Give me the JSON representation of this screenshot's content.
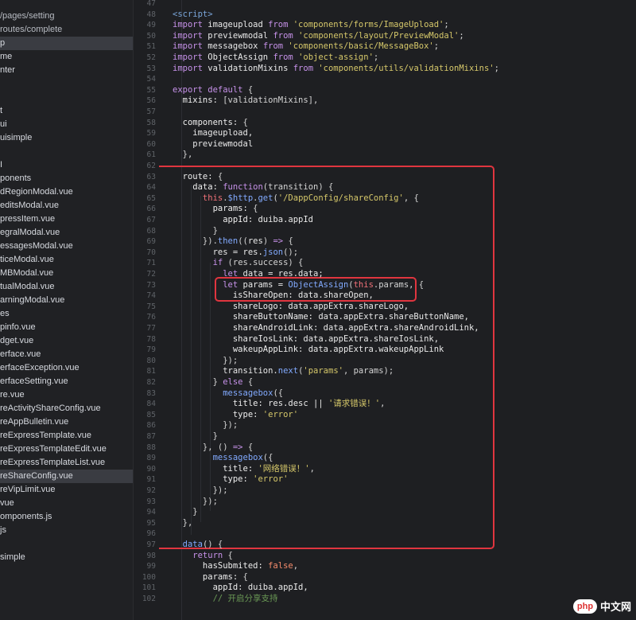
{
  "sidebar": {
    "items": [
      {
        "label": "/pages/setting",
        "style": "path"
      },
      {
        "label": "routes/complete",
        "style": "path"
      },
      {
        "label": "p",
        "style": "active"
      },
      {
        "label": "me",
        "style": ""
      },
      {
        "label": "nter",
        "style": ""
      },
      {
        "label": "",
        "style": ""
      },
      {
        "label": "",
        "style": ""
      },
      {
        "label": "t",
        "style": ""
      },
      {
        "label": "ui",
        "style": ""
      },
      {
        "label": "uisimple",
        "style": ""
      },
      {
        "label": "",
        "style": ""
      },
      {
        "label": "I",
        "style": ""
      },
      {
        "label": "ponents",
        "style": ""
      },
      {
        "label": "dRegionModal.vue",
        "style": ""
      },
      {
        "label": "editsModal.vue",
        "style": ""
      },
      {
        "label": "pressItem.vue",
        "style": ""
      },
      {
        "label": "egralModal.vue",
        "style": ""
      },
      {
        "label": "essagesModal.vue",
        "style": ""
      },
      {
        "label": "ticeModal.vue",
        "style": ""
      },
      {
        "label": "MBModal.vue",
        "style": ""
      },
      {
        "label": "tualModal.vue",
        "style": ""
      },
      {
        "label": "arningModal.vue",
        "style": ""
      },
      {
        "label": "es",
        "style": ""
      },
      {
        "label": "pinfo.vue",
        "style": ""
      },
      {
        "label": "dget.vue",
        "style": ""
      },
      {
        "label": "erface.vue",
        "style": ""
      },
      {
        "label": "erfaceException.vue",
        "style": ""
      },
      {
        "label": "erfaceSetting.vue",
        "style": ""
      },
      {
        "label": "re.vue",
        "style": ""
      },
      {
        "label": "reActivityShareConfig.vue",
        "style": ""
      },
      {
        "label": "reAppBulletin.vue",
        "style": ""
      },
      {
        "label": "reExpressTemplate.vue",
        "style": ""
      },
      {
        "label": "reExpressTemplateEdit.vue",
        "style": ""
      },
      {
        "label": "reExpressTemplateList.vue",
        "style": ""
      },
      {
        "label": "reShareConfig.vue",
        "style": "active"
      },
      {
        "label": "reVipLimit.vue",
        "style": ""
      },
      {
        "label": "vue",
        "style": ""
      },
      {
        "label": "omponents.js",
        "style": ""
      },
      {
        "label": "js",
        "style": ""
      },
      {
        "label": "",
        "style": ""
      },
      {
        "label": "simple",
        "style": ""
      }
    ]
  },
  "editor": {
    "line_numbers": [
      "47",
      "48",
      "49",
      "50",
      "51",
      "52",
      "53",
      "54",
      "55",
      "56",
      "57",
      "58",
      "59",
      "60",
      "61",
      "62",
      "63",
      "64",
      "65",
      "66",
      "67",
      "68",
      "69",
      "70",
      "71",
      "72",
      "73",
      "74",
      "75",
      "76",
      "77",
      "78",
      "79",
      "80",
      "81",
      "82",
      "83",
      "84",
      "85",
      "86",
      "87",
      "88",
      "89",
      "90",
      "91",
      "92",
      "93",
      "94",
      "95",
      "96",
      "97",
      "98",
      "99",
      "100",
      "101",
      "102"
    ],
    "lines": [
      [],
      [
        [
          "tag",
          "<script>"
        ]
      ],
      [
        [
          "kw",
          "import "
        ],
        [
          "id",
          "imageupload "
        ],
        [
          "kw",
          "from "
        ],
        [
          "str",
          "'components/forms/ImageUpload'"
        ],
        [
          "punc",
          ";"
        ]
      ],
      [
        [
          "kw",
          "import "
        ],
        [
          "id",
          "previewmodal "
        ],
        [
          "kw",
          "from "
        ],
        [
          "str",
          "'components/layout/PreviewModal'"
        ],
        [
          "punc",
          ";"
        ]
      ],
      [
        [
          "kw",
          "import "
        ],
        [
          "id",
          "messagebox "
        ],
        [
          "kw",
          "from "
        ],
        [
          "str",
          "'components/basic/MessageBox'"
        ],
        [
          "punc",
          ";"
        ]
      ],
      [
        [
          "kw",
          "import "
        ],
        [
          "id",
          "ObjectAssign "
        ],
        [
          "kw",
          "from "
        ],
        [
          "str",
          "'object-assign'"
        ],
        [
          "punc",
          ";"
        ]
      ],
      [
        [
          "kw",
          "import "
        ],
        [
          "id",
          "validationMixins "
        ],
        [
          "kw",
          "from "
        ],
        [
          "str",
          "'components/utils/validationMixins'"
        ],
        [
          "punc",
          ";"
        ]
      ],
      [],
      [
        [
          "kw",
          "export default "
        ],
        [
          "punc",
          "{"
        ]
      ],
      [
        [
          "prop",
          "  mixins: "
        ],
        [
          "punc",
          "[validationMixins],"
        ]
      ],
      [],
      [
        [
          "prop",
          "  components: "
        ],
        [
          "punc",
          "{"
        ]
      ],
      [
        [
          "id",
          "    imageupload,"
        ]
      ],
      [
        [
          "id",
          "    previewmodal"
        ]
      ],
      [
        [
          "punc",
          "  },"
        ]
      ],
      [],
      [
        [
          "prop",
          "  route: "
        ],
        [
          "punc",
          "{"
        ]
      ],
      [
        [
          "prop",
          "    data: "
        ],
        [
          "kw",
          "function"
        ],
        [
          "punc",
          "(transition) {"
        ]
      ],
      [
        [
          "this",
          "      this"
        ],
        [
          "punc",
          "."
        ],
        [
          "fn",
          "$http"
        ],
        [
          "punc",
          "."
        ],
        [
          "fn",
          "get"
        ],
        [
          "punc",
          "("
        ],
        [
          "str",
          "'/DappConfig/shareConfig'"
        ],
        [
          "punc",
          ", {"
        ]
      ],
      [
        [
          "prop",
          "        params: "
        ],
        [
          "punc",
          "{"
        ]
      ],
      [
        [
          "prop",
          "          appId: "
        ],
        [
          "id",
          "duiba.appId"
        ]
      ],
      [
        [
          "punc",
          "        }"
        ]
      ],
      [
        [
          "punc",
          "      })."
        ],
        [
          "fn",
          "then"
        ],
        [
          "punc",
          "(("
        ],
        [
          "id",
          "res"
        ],
        [
          "punc",
          ") "
        ],
        [
          "kw",
          "=>"
        ],
        [
          "punc",
          " {"
        ]
      ],
      [
        [
          "id",
          "        res = res."
        ],
        [
          "fn",
          "json"
        ],
        [
          "punc",
          "();"
        ]
      ],
      [
        [
          "kw",
          "        if "
        ],
        [
          "punc",
          "(res.success) {"
        ]
      ],
      [
        [
          "kw",
          "          let "
        ],
        [
          "id",
          "data = res.data;"
        ]
      ],
      [
        [
          "kw",
          "          let "
        ],
        [
          "id",
          "params = "
        ],
        [
          "fn",
          "ObjectAssign"
        ],
        [
          "punc",
          "("
        ],
        [
          "this",
          "this"
        ],
        [
          "punc",
          ".params, {"
        ]
      ],
      [
        [
          "prop",
          "            isShareOpen: "
        ],
        [
          "id",
          "data.shareOpen,"
        ]
      ],
      [
        [
          "prop",
          "            shareLogo: "
        ],
        [
          "id",
          "data.appExtra.shareLogo,"
        ]
      ],
      [
        [
          "prop",
          "            shareButtonName: "
        ],
        [
          "id",
          "data.appExtra.shareButtonName,"
        ]
      ],
      [
        [
          "prop",
          "            shareAndroidLink: "
        ],
        [
          "id",
          "data.appExtra.shareAndroidLink,"
        ]
      ],
      [
        [
          "prop",
          "            shareIosLink: "
        ],
        [
          "id",
          "data.appExtra.shareIosLink,"
        ]
      ],
      [
        [
          "prop",
          "            wakeupAppLink: "
        ],
        [
          "id",
          "data.appExtra.wakeupAppLink"
        ]
      ],
      [
        [
          "punc",
          "          });"
        ]
      ],
      [
        [
          "id",
          "          transition."
        ],
        [
          "fn",
          "next"
        ],
        [
          "punc",
          "("
        ],
        [
          "str",
          "'params'"
        ],
        [
          "punc",
          ", params);"
        ]
      ],
      [
        [
          "punc",
          "        } "
        ],
        [
          "kw",
          "else "
        ],
        [
          "punc",
          "{"
        ]
      ],
      [
        [
          "fn",
          "          messagebox"
        ],
        [
          "punc",
          "({"
        ]
      ],
      [
        [
          "prop",
          "            title: "
        ],
        [
          "id",
          "res.desc || "
        ],
        [
          "str",
          "'请求错误！'"
        ],
        [
          "punc",
          ","
        ]
      ],
      [
        [
          "prop",
          "            type: "
        ],
        [
          "str",
          "'error'"
        ]
      ],
      [
        [
          "punc",
          "          });"
        ]
      ],
      [
        [
          "punc",
          "        }"
        ]
      ],
      [
        [
          "punc",
          "      }, () "
        ],
        [
          "kw",
          "=>"
        ],
        [
          "punc",
          " {"
        ]
      ],
      [
        [
          "fn",
          "        messagebox"
        ],
        [
          "punc",
          "({"
        ]
      ],
      [
        [
          "prop",
          "          title: "
        ],
        [
          "str",
          "'网络错误！'"
        ],
        [
          "punc",
          ","
        ]
      ],
      [
        [
          "prop",
          "          type: "
        ],
        [
          "str",
          "'error'"
        ]
      ],
      [
        [
          "punc",
          "        });"
        ]
      ],
      [
        [
          "punc",
          "      });"
        ]
      ],
      [
        [
          "punc",
          "    }"
        ]
      ],
      [
        [
          "punc",
          "  },"
        ]
      ],
      [],
      [
        [
          "fn",
          "  data"
        ],
        [
          "punc",
          "() {"
        ]
      ],
      [
        [
          "kw",
          "    return "
        ],
        [
          "punc",
          "{"
        ]
      ],
      [
        [
          "prop",
          "      hasSubmited: "
        ],
        [
          "bool",
          "false"
        ],
        [
          "punc",
          ","
        ]
      ],
      [
        [
          "prop",
          "      params: "
        ],
        [
          "punc",
          "{"
        ]
      ],
      [
        [
          "prop",
          "        appId: "
        ],
        [
          "id",
          "duiba.appId,"
        ]
      ],
      [
        [
          "cmt",
          "        // 开启分享支持"
        ]
      ]
    ]
  },
  "watermark": {
    "logo_text": "php",
    "site_text": "中文网"
  }
}
